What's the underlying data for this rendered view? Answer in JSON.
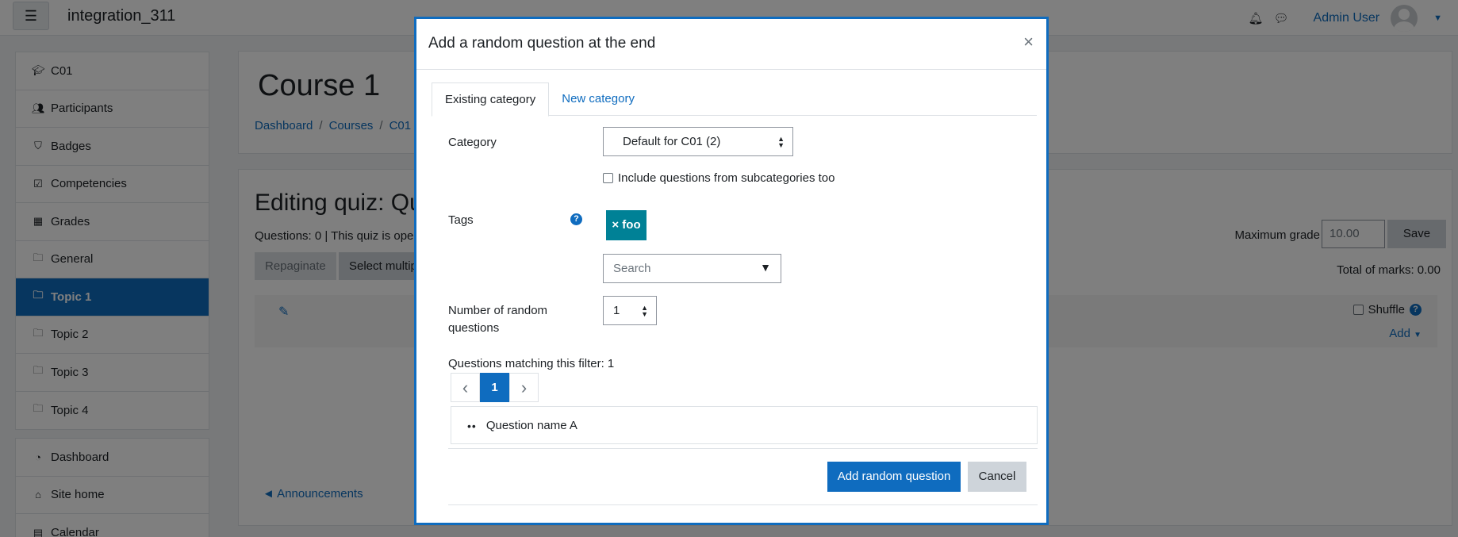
{
  "navbar": {
    "site_name": "integration_311",
    "user_name": "Admin User"
  },
  "sidebar": {
    "groups": [
      [
        {
          "label": "C01",
          "icon": "graduation-cap-icon"
        },
        {
          "label": "Participants",
          "icon": "users-icon"
        },
        {
          "label": "Badges",
          "icon": "shield-icon"
        },
        {
          "label": "Competencies",
          "icon": "check-square-icon"
        },
        {
          "label": "Grades",
          "icon": "table-icon"
        },
        {
          "label": "General",
          "icon": "folder-icon"
        },
        {
          "label": "Topic 1",
          "icon": "folder-icon"
        },
        {
          "label": "Topic 2",
          "icon": "folder-icon"
        },
        {
          "label": "Topic 3",
          "icon": "folder-icon"
        },
        {
          "label": "Topic 4",
          "icon": "folder-icon"
        }
      ],
      [
        {
          "label": "Dashboard",
          "icon": "tachometer-icon"
        },
        {
          "label": "Site home",
          "icon": "home-icon"
        },
        {
          "label": "Calendar",
          "icon": "calendar-icon"
        }
      ]
    ],
    "active": "Topic 1"
  },
  "course": {
    "title": "Course 1",
    "breadcrumb": [
      "Dashboard",
      "Courses",
      "C01"
    ]
  },
  "quiz": {
    "title": "Editing quiz: Qu",
    "info": "Questions: 0 | This quiz is ope",
    "repaginate_label": "Repaginate",
    "select_multiple_label": "Select multip",
    "max_grade_label": "Maximum grade",
    "max_grade_value": "10.00",
    "save_label": "Save",
    "total_marks": "Total of marks: 0.00",
    "shuffle_label": "Shuffle",
    "add_label": "Add",
    "announcements_label": "◄ Announcements"
  },
  "modal": {
    "title": "Add a random question at the end",
    "close_glyph": "×",
    "tabs": [
      "Existing category",
      "New category"
    ],
    "category_label": "Category",
    "category_value": "Default for C01 (2)",
    "subcategories_label": "Include questions from subcategories too",
    "tags_label": "Tags",
    "tag_badge": "× foo",
    "search_placeholder": "Search",
    "num_random_label": "Number of random questions",
    "num_random_value": "1",
    "matching_text": "Questions matching this filter: 1",
    "pager": {
      "prev": "‹",
      "current": "1",
      "next": "›"
    },
    "questions": [
      "Question name A"
    ],
    "add_button": "Add random question",
    "cancel_button": "Cancel"
  },
  "colors": {
    "primary": "#0f6cbf",
    "tag": "#008196",
    "overlay": "rgba(0,0,0,0.5)"
  }
}
